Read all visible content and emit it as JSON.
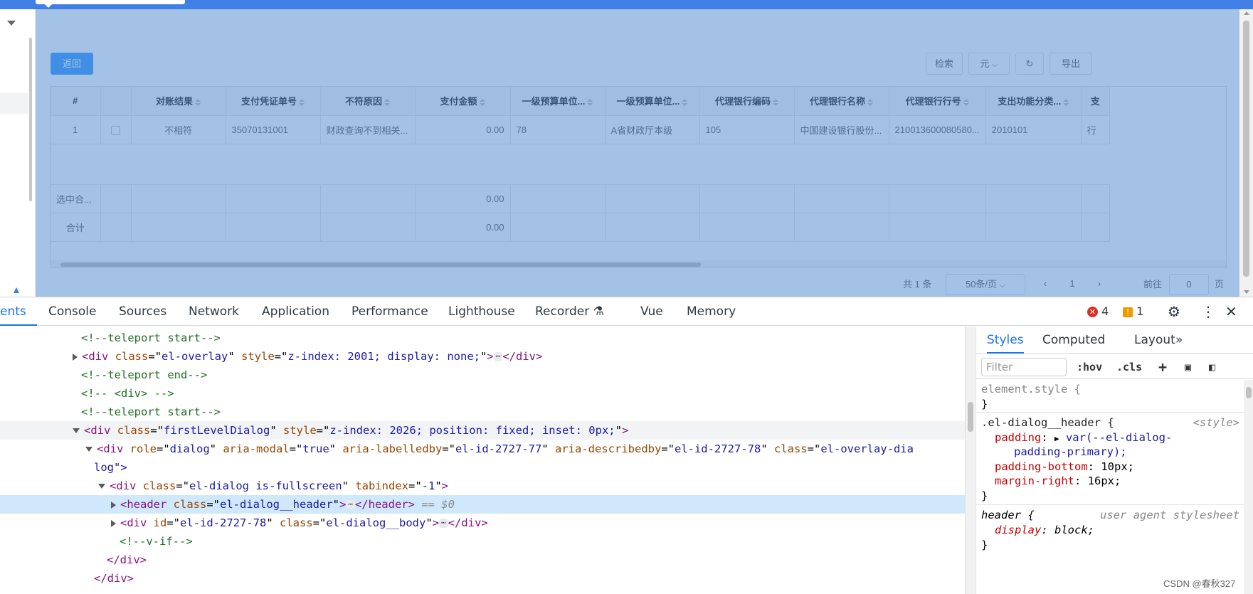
{
  "app": {
    "back_label": "返回",
    "tools": {
      "search": "检索",
      "unit": "元",
      "unit_arrow": "⌵",
      "refresh": "↻",
      "export": "导出"
    },
    "table": {
      "columns": [
        "#",
        "",
        "对账结果",
        "支付凭证单号",
        "不符原因",
        "支付金额",
        "一级预算单位...",
        "一级预算单位...",
        "代理银行编码",
        "代理银行名称",
        "代理银行行号",
        "支出功能分类...",
        "支"
      ],
      "row": [
        "1",
        "",
        "不相符",
        "35070131001",
        "财政查询不到相关...",
        "0.00",
        "78",
        "A省财政厅本级",
        "105",
        "中国建设银行股份...",
        "210013600080580...",
        "2010101",
        "行"
      ],
      "selected_sum": {
        "label": "选中合...",
        "amount": "0.00"
      },
      "total": {
        "label": "合计",
        "amount": "0.00"
      }
    },
    "pager": {
      "total": "共 1 条",
      "page_size": "50条/页",
      "prev": "‹",
      "page": "1",
      "next": "›",
      "goto": "前往",
      "goto_value": "0",
      "page_unit": "页"
    }
  },
  "devtools": {
    "tabs": [
      "ents",
      "Console",
      "Sources",
      "Network",
      "Application",
      "Performance",
      "Lighthouse",
      "Recorder",
      "Vue",
      "Memory"
    ],
    "errors": "4",
    "warnings": "1",
    "elements_lines": [
      {
        "indent": 0,
        "kind": "comment",
        "text": "<!--teleport start-->"
      },
      {
        "indent": 0,
        "kind": "collapsed",
        "tag": "div",
        "attrs": [
          [
            "class",
            "el-overlay"
          ],
          [
            "style",
            "z-index: 2001; display: none;"
          ]
        ]
      },
      {
        "indent": 0,
        "kind": "comment",
        "text": "<!--teleport end-->"
      },
      {
        "indent": 0,
        "kind": "comment",
        "text": "<!-- <div> -->"
      },
      {
        "indent": 0,
        "kind": "comment",
        "text": "<!--teleport start-->"
      },
      {
        "indent": 0,
        "kind": "open",
        "tag": "div",
        "attrs": [
          [
            "class",
            "firstLevelDialog"
          ],
          [
            "style",
            "z-index: 2026; position: fixed; inset: 0px;"
          ]
        ]
      },
      {
        "indent": 1,
        "kind": "open",
        "tag": "div",
        "attrs": [
          [
            "role",
            "dialog"
          ],
          [
            "aria-modal",
            "true"
          ],
          [
            "aria-labelledby",
            "el-id-2727-77"
          ],
          [
            "aria-describedby",
            "el-id-2727-78"
          ],
          [
            "class",
            "el-overlay-dia"
          ]
        ]
      },
      {
        "indent": 1,
        "kind": "cont",
        "text": "log\">"
      },
      {
        "indent": 2,
        "kind": "open",
        "tag": "div",
        "attrs": [
          [
            "class",
            "el-dialog is-fullscreen"
          ],
          [
            "tabindex",
            "-1"
          ]
        ]
      },
      {
        "indent": 3,
        "kind": "collapsed",
        "tag": "header",
        "attrs": [
          [
            "class",
            "el-dialog__header"
          ]
        ],
        "suffix": "== $0"
      },
      {
        "indent": 3,
        "kind": "collapsed",
        "tag": "div",
        "attrs": [
          [
            "id",
            "el-id-2727-78"
          ],
          [
            "class",
            "el-dialog__body"
          ]
        ]
      },
      {
        "indent": 3,
        "kind": "comment",
        "text": "<!--v-if-->"
      },
      {
        "indent": 2,
        "kind": "close",
        "text": "</div>"
      },
      {
        "indent": 1,
        "kind": "close",
        "text": "</div>"
      }
    ],
    "styles_tabs": [
      "Styles",
      "Computed",
      "Layout",
      "»"
    ],
    "filter_placeholder": "Filter",
    "hov": ":hov",
    "cls": ".cls",
    "rules": {
      "element_style": "element.style {",
      "close": "}",
      "dialog_header_selector": ".el-dialog__header {",
      "dialog_header_src": "<style>",
      "padding_prop": "padding",
      "padding_val": "var(--el-dialog-",
      "padding_val2": "padding-primary);",
      "pb_prop": "padding-bottom",
      "pb_val": "10px;",
      "mr_prop": "margin-right",
      "mr_val": "16px;",
      "header_selector": "header {",
      "header_src": "user agent stylesheet",
      "display_prop": "display",
      "display_val": "block;"
    }
  },
  "watermark": "CSDN @春秋327"
}
